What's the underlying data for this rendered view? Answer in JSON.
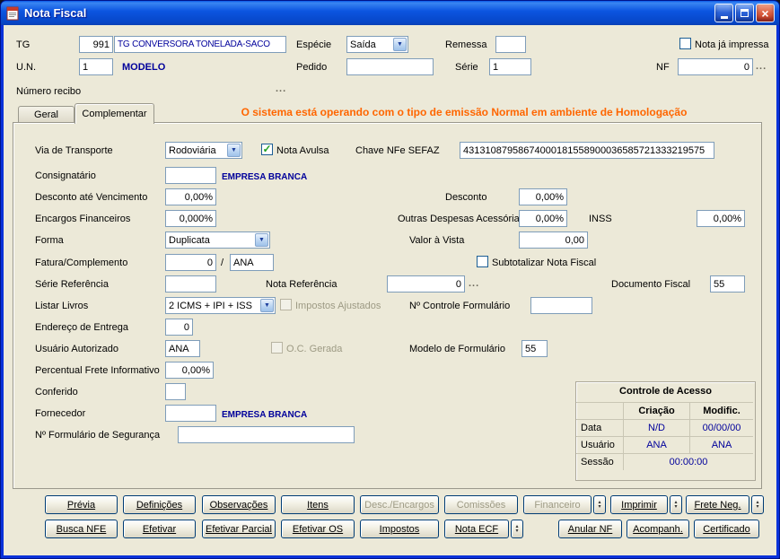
{
  "window": {
    "title": "Nota Fiscal"
  },
  "icons": {
    "close": "×",
    "dropdown": "▼",
    "check": "✓",
    "dots": "...",
    "up": "▴",
    "down": "▾"
  },
  "colors": {
    "status_text": "#FF6600",
    "value_text": "#00009B",
    "check_green": "#21A121"
  },
  "header": {
    "tg": {
      "label": "TG",
      "code": "991",
      "name": "TG CONVERSORA TONELADA-SACO"
    },
    "especie": {
      "label": "Espécie",
      "value": "Saída"
    },
    "remessa": {
      "label": "Remessa",
      "value": ""
    },
    "nota_ja_impressa": {
      "label": "Nota já impressa",
      "checked": false
    },
    "un": {
      "label": "U.N.",
      "value": "1"
    },
    "modelo_label": "MODELO",
    "pedido": {
      "label": "Pedido",
      "value": ""
    },
    "serie": {
      "label": "Série",
      "value": "1"
    },
    "nf": {
      "label": "NF",
      "value": "0"
    },
    "numero_recibo_label": "Número recibo"
  },
  "tabs": [
    {
      "label": "Geral",
      "active": false
    },
    {
      "label": "Complementar",
      "active": true
    }
  ],
  "status_message": "O sistema está operando com o tipo de emissão Normal em ambiente de Homologação",
  "form": {
    "via_de_transporte": {
      "label": "Via de Transporte",
      "value": "Rodoviária"
    },
    "nota_avulsa": {
      "label": "Nota Avulsa",
      "checked": true
    },
    "chave_nfe_sefaz": {
      "label": "Chave NFe SEFAZ",
      "value": "43131087958674000181558900036585721333219575"
    },
    "consignatario": {
      "label": "Consignatário",
      "value": "",
      "company": "EMPRESA BRANCA"
    },
    "desconto_ate_vencimento": {
      "label": "Desconto até Vencimento",
      "value": "0,00%"
    },
    "desconto": {
      "label": "Desconto",
      "value": "0,00%"
    },
    "encargos_financeiros": {
      "label": "Encargos Financeiros",
      "value": "0,000%"
    },
    "outras_despesas_acessorias": {
      "label": "Outras Despesas Acessórias",
      "value": "0,00%"
    },
    "inss": {
      "label": "INSS",
      "value": "0,00%"
    },
    "forma": {
      "label": "Forma",
      "value": "Duplicata"
    },
    "valor_a_vista": {
      "label": "Valor à Vista",
      "value": "0,00"
    },
    "fatura_complemento": {
      "label": "Fatura/Complemento",
      "value": "0",
      "separator": "/",
      "value2": "ANA"
    },
    "subtotalizar_nota_fiscal": {
      "label": "Subtotalizar Nota Fiscal",
      "checked": false
    },
    "serie_referencia": {
      "label": "Série Referência",
      "value": ""
    },
    "nota_referencia": {
      "label": "Nota Referência",
      "value": "0"
    },
    "documento_fiscal": {
      "label": "Documento Fiscal",
      "value": "55"
    },
    "listar_livros": {
      "label": "Listar Livros",
      "value": "2 ICMS + IPI + ISS"
    },
    "impostos_ajustados": {
      "label": "Impostos Ajustados",
      "checked": false,
      "disabled": true
    },
    "n_controle_formulario": {
      "label": "Nº Controle Formulário",
      "value": ""
    },
    "endereco_de_entrega": {
      "label": "Endereço de Entrega",
      "value": "0"
    },
    "usuario_autorizado": {
      "label": "Usuário Autorizado",
      "value": "ANA"
    },
    "oc_gerada": {
      "label": "O.C. Gerada",
      "checked": false,
      "disabled": true
    },
    "modelo_de_formulario": {
      "label": "Modelo de Formulário",
      "value": "55"
    },
    "percentual_frete_informativo": {
      "label": "Percentual Frete Informativo",
      "value": "0,00%"
    },
    "conferido": {
      "label": "Conferido",
      "value": ""
    },
    "fornecedor": {
      "label": "Fornecedor",
      "value": "",
      "company": "EMPRESA BRANCA"
    },
    "n_formulario_de_seguranca": {
      "label": "Nº Formulário de Segurança",
      "value": ""
    }
  },
  "access_control": {
    "title": "Controle de Acesso",
    "columns": [
      "Criação",
      "Modific."
    ],
    "rows": [
      {
        "label": "Data",
        "criacao": "N/D",
        "modific": "00/00/00"
      },
      {
        "label": "Usuário",
        "criacao": "ANA",
        "modific": "ANA"
      },
      {
        "label": "Sessão",
        "session": "00:00:00"
      }
    ]
  },
  "buttons": {
    "row1": [
      {
        "label": "Prévia",
        "enabled": true
      },
      {
        "label": "Definições",
        "enabled": true
      },
      {
        "label": "Observações",
        "enabled": true
      },
      {
        "label": "Itens",
        "enabled": true
      },
      {
        "label": "Desc./Encargos",
        "enabled": false
      },
      {
        "label": "Comissões",
        "enabled": false
      },
      {
        "label": "Financeiro",
        "enabled": false
      },
      {
        "label": "Imprimir",
        "enabled": true
      },
      {
        "label": "Frete Neg.",
        "enabled": true
      }
    ],
    "row2": [
      {
        "label": "Busca NFE",
        "enabled": true
      },
      {
        "label": "Efetivar",
        "enabled": true
      },
      {
        "label": "Efetivar Parcial",
        "enabled": true
      },
      {
        "label": "Efetivar OS",
        "enabled": true
      },
      {
        "label": "Impostos",
        "enabled": true
      },
      {
        "label": "Nota ECF",
        "enabled": true
      },
      {
        "label": "Anular NF",
        "enabled": true
      },
      {
        "label": "Acompanh.",
        "enabled": true
      },
      {
        "label": "Certificado",
        "enabled": true
      }
    ]
  }
}
